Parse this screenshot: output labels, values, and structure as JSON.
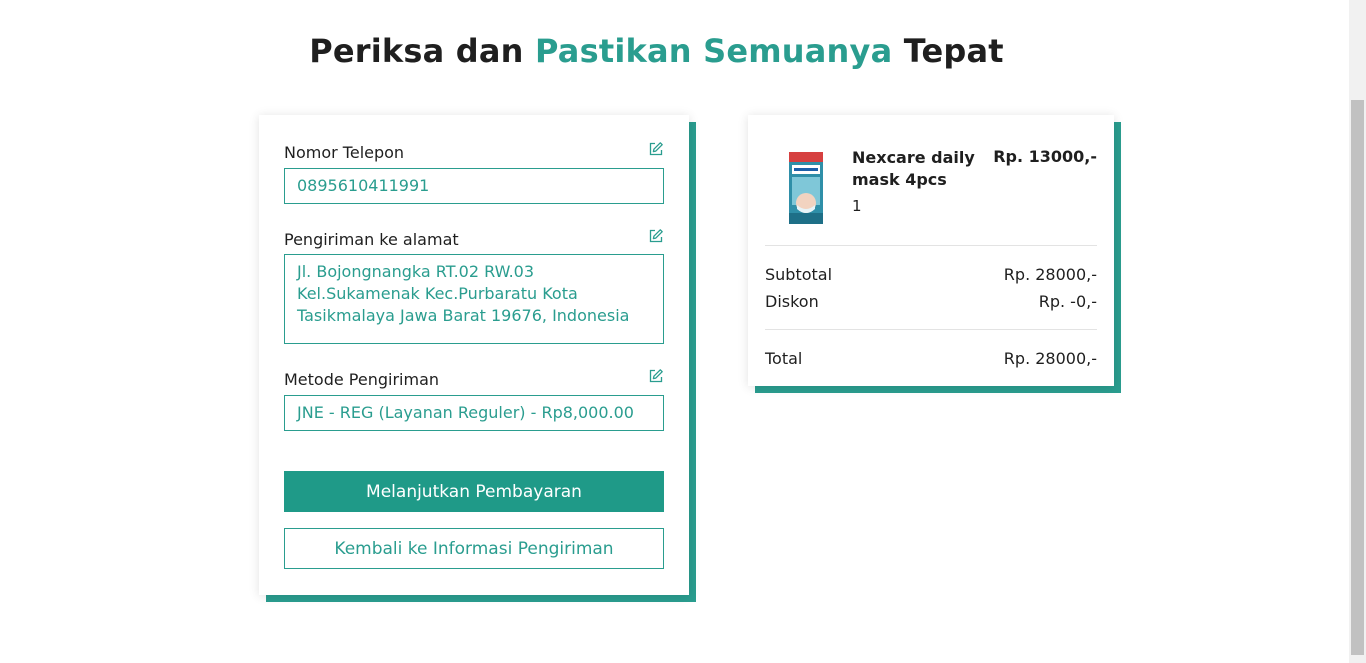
{
  "heading": {
    "part1": "Periksa dan ",
    "accent": "Pastikan Semuanya",
    "part2": " Tepat"
  },
  "form": {
    "phone_label": "Nomor Telepon",
    "phone_value": "0895610411991",
    "address_label": "Pengiriman ke alamat",
    "address_value": "Jl. Bojongnangka RT.02 RW.03 Kel.Sukamenak Kec.Purbaratu Kota Tasikmalaya Jawa Barat 19676, Indonesia",
    "shipping_label": "Metode Pengiriman",
    "shipping_value": "JNE - REG (Layanan Reguler) - Rp8,000.00",
    "continue_button": "Melanjutkan Pembayaran",
    "back_button": "Kembali ke Informasi Pengiriman",
    "edit_icon": "edit-icon"
  },
  "summary": {
    "item": {
      "name": "Nexcare daily mask 4pcs",
      "qty": "1",
      "price": "Rp. 13000,-"
    },
    "subtotal_label": "Subtotal",
    "subtotal_value": "Rp. 28000,-",
    "discount_label": "Diskon",
    "discount_value": "Rp. -0,-",
    "total_label": "Total",
    "total_value": "Rp. 28000,-"
  },
  "colors": {
    "accent": "#2a9d8f",
    "button": "#1f9a88"
  }
}
